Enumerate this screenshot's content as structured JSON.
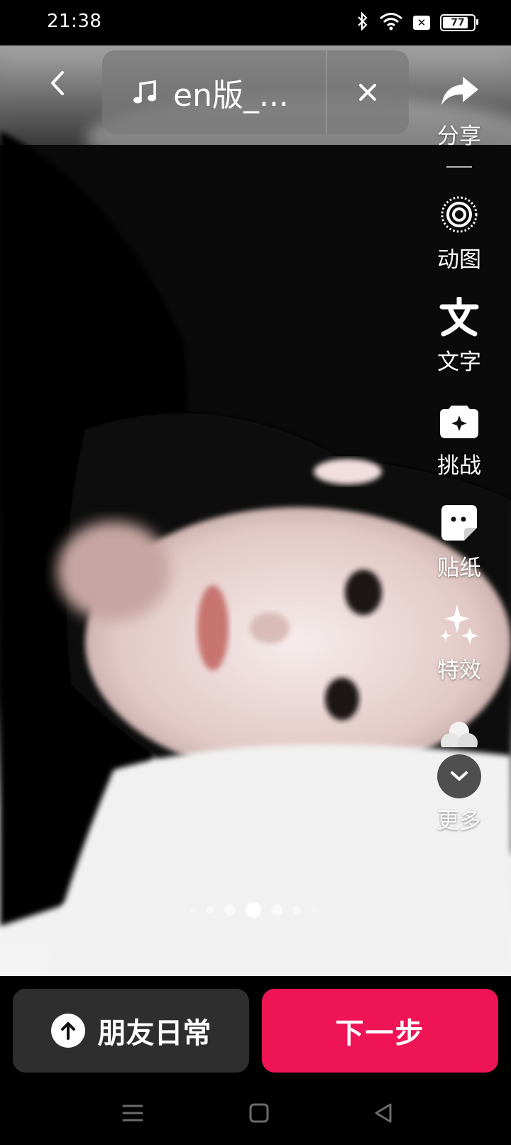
{
  "status": {
    "time": "21:38",
    "battery": "77"
  },
  "topbar": {
    "music_title": "en版_..."
  },
  "tools": {
    "share": "分享",
    "live_photo": "动图",
    "text": "文字",
    "challenge": "挑战",
    "sticker": "贴纸",
    "effects": "特效",
    "more": "更多"
  },
  "bottom": {
    "friends_label": "朋友日常",
    "next_label": "下一步"
  },
  "colors": {
    "next_button": "#ee1456",
    "friends_button": "#2e2e2e"
  },
  "pager": {
    "current": 4,
    "total": 7
  }
}
